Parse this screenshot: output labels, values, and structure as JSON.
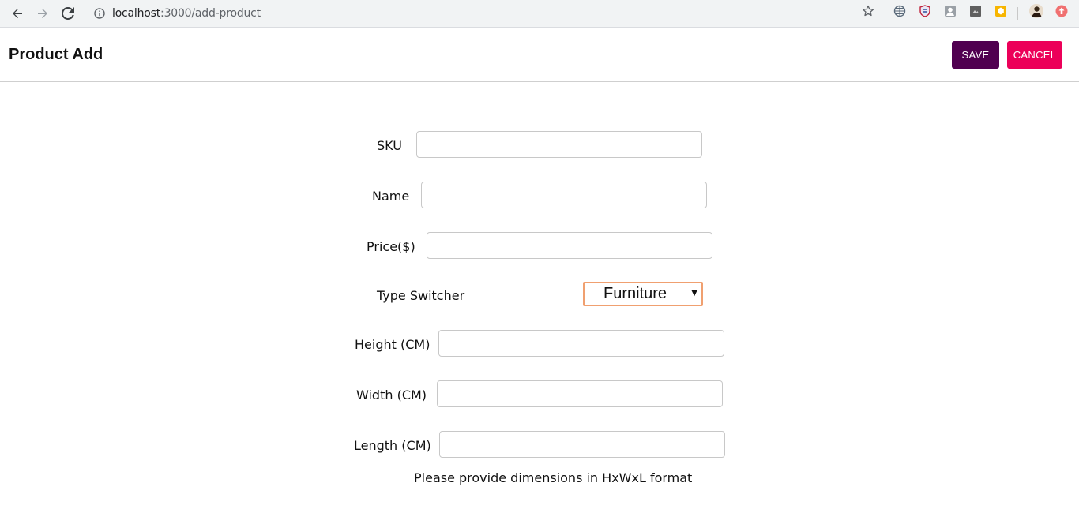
{
  "browser": {
    "url_host": "localhost",
    "url_path": ":3000/add-product"
  },
  "header": {
    "title": "Product Add",
    "save_label": "SAVE",
    "cancel_label": "CANCEL"
  },
  "form": {
    "sku_label": "SKU",
    "name_label": "Name",
    "price_label": "Price($)",
    "type_label": "Type Switcher",
    "type_value": "Furniture",
    "height_label": "Height (CM)",
    "width_label": "Width (CM)",
    "length_label": "Length (CM)",
    "hint": "Please provide dimensions in HxWxL format"
  },
  "colors": {
    "save_bg": "#500050",
    "cancel_bg": "#ec0059",
    "select_border": "#f0a070"
  },
  "icons": {
    "back": "arrow-left-icon",
    "forward": "arrow-right-icon",
    "reload": "reload-icon",
    "site_info": "info-icon",
    "bookmark": "star-icon"
  }
}
